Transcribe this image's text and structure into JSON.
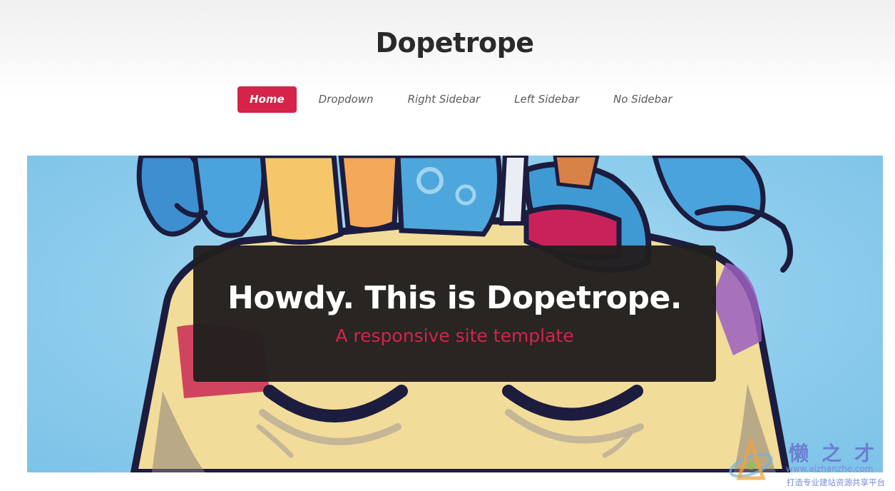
{
  "site": {
    "title": "Dopetrope"
  },
  "nav": {
    "items": [
      {
        "label": "Home",
        "active": true
      },
      {
        "label": "Dropdown",
        "active": false
      },
      {
        "label": "Right Sidebar",
        "active": false
      },
      {
        "label": "Left Sidebar",
        "active": false
      },
      {
        "label": "No Sidebar",
        "active": false
      }
    ]
  },
  "banner": {
    "title": "Howdy. This is Dopetrope.",
    "subtitle": "A responsive site template",
    "illustration": "cartoon-character-head-illustration"
  },
  "watermark": {
    "cn_name": "懒之才",
    "url": "www.aizhanzhe.com",
    "slogan": "打造专业建站资源共享平台"
  },
  "colors": {
    "accent": "#d52349",
    "title_text": "#2a2a2a",
    "nav_text": "#5a5a5a",
    "caption_bg": "#221f1f",
    "banner_sky": "#8fcdec"
  }
}
